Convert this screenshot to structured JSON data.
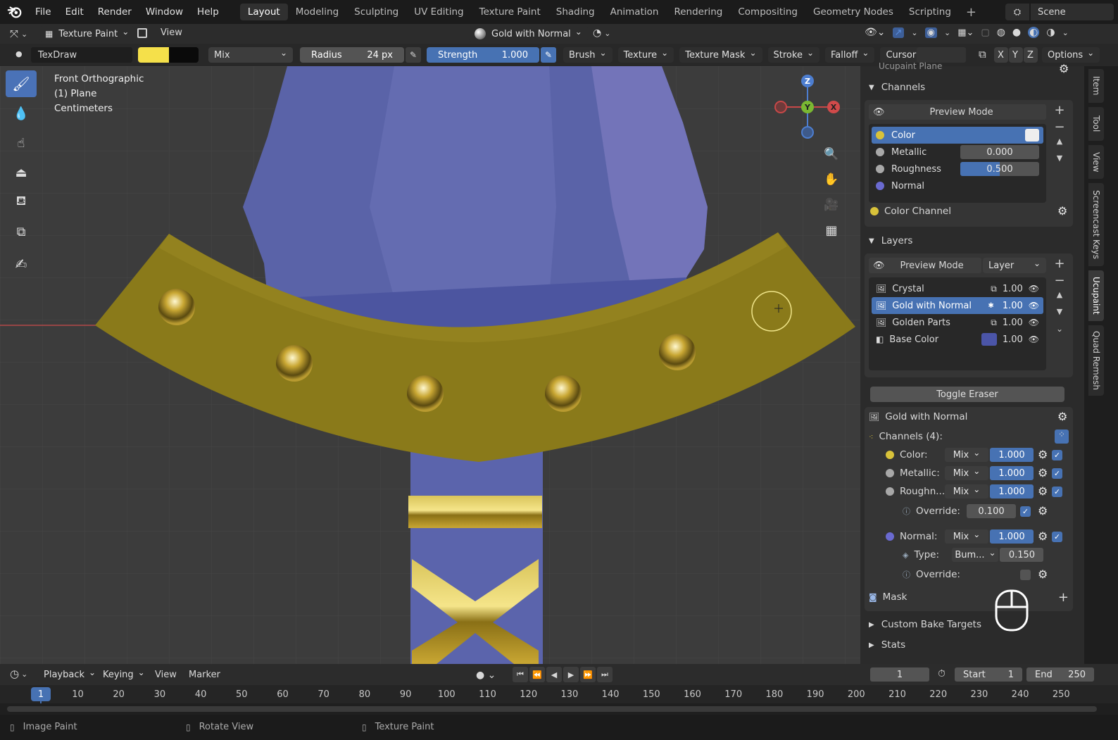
{
  "menu": [
    "File",
    "Edit",
    "Render",
    "Window",
    "Help"
  ],
  "workspaces": [
    "Layout",
    "Modeling",
    "Sculpting",
    "UV Editing",
    "Texture Paint",
    "Shading",
    "Animation",
    "Rendering",
    "Compositing",
    "Geometry Nodes",
    "Scripting"
  ],
  "scene": "Scene",
  "header": {
    "mode": "Texture Paint",
    "view": "View",
    "material": "Gold with Normal"
  },
  "toolheader": {
    "brush_name": "TexDraw",
    "color_primary": "#f5e04a",
    "color_secondary": "#0a0a0a",
    "blend": "Mix",
    "radius_label": "Radius",
    "radius_value": "24 px",
    "strength_label": "Strength",
    "strength_value": "1.000",
    "menus": [
      "Brush",
      "Texture",
      "Texture Mask",
      "Stroke",
      "Falloff",
      "Cursor"
    ],
    "axes": [
      "X",
      "Y",
      "Z"
    ],
    "options": "Options"
  },
  "viewport": {
    "line1": "Front Orthographic",
    "line2": "(1) Plane",
    "line3": "Centimeters",
    "gizmo": {
      "z": "Z",
      "y": "Y",
      "x": "X"
    }
  },
  "panel": {
    "occluded_title": "Ucupaint Plane",
    "channels_title": "Channels",
    "channels_preview": "Preview Mode",
    "channels": [
      {
        "name": "Color",
        "color": "#d8c23a",
        "value": ""
      },
      {
        "name": "Metallic",
        "color": "#a8a8a8",
        "value": "0.000"
      },
      {
        "name": "Roughness",
        "color": "#a8a8a8",
        "value": "0.500"
      },
      {
        "name": "Normal",
        "color": "#6a6ad0",
        "value": ""
      }
    ],
    "color_channel": "Color Channel",
    "layers_title": "Layers",
    "layers_preview": "Preview Mode",
    "layers_type": "Layer",
    "layers": [
      {
        "name": "Crystal",
        "value": "1.00"
      },
      {
        "name": "Gold with Normal",
        "value": "1.00"
      },
      {
        "name": "Golden Parts",
        "value": "1.00"
      },
      {
        "name": "Base Color",
        "value": "1.00"
      }
    ],
    "toggle_eraser": "Toggle Eraser",
    "layer_name": "Gold with Normal",
    "channels_count": "Channels (4):",
    "layer_channels": [
      {
        "label": "Color:",
        "blend": "Mix",
        "value": "1.000"
      },
      {
        "label": "Metallic:",
        "blend": "Mix",
        "value": "1.000"
      },
      {
        "label": "Roughn...",
        "blend": "Mix",
        "value": "1.000"
      },
      {
        "label": "Normal:",
        "blend": "Mix",
        "value": "1.000"
      }
    ],
    "override1_label": "Override:",
    "override1_value": "0.100",
    "type_label": "Type:",
    "type_value": "Bum...",
    "type_num": "0.150",
    "override2_label": "Override:",
    "mask": "Mask",
    "custom_bake": "Custom Bake Targets",
    "stats": "Stats"
  },
  "ntabs": [
    "Item",
    "Tool",
    "View",
    "Screencast Keys",
    "Ucupaint",
    "Quad Remesh"
  ],
  "timeline": {
    "menus": [
      "Playback",
      "Keying",
      "View",
      "Marker"
    ],
    "current_frame": "1",
    "start_label": "Start",
    "start": "1",
    "end_label": "End",
    "end": "250",
    "ticks": [
      "1",
      "10",
      "20",
      "30",
      "40",
      "50",
      "60",
      "70",
      "80",
      "90",
      "100",
      "110",
      "120",
      "130",
      "140",
      "150",
      "160",
      "170",
      "180",
      "190",
      "200",
      "210",
      "220",
      "230",
      "240",
      "250"
    ]
  },
  "status": [
    "Image Paint",
    "Rotate View",
    "Texture Paint"
  ]
}
